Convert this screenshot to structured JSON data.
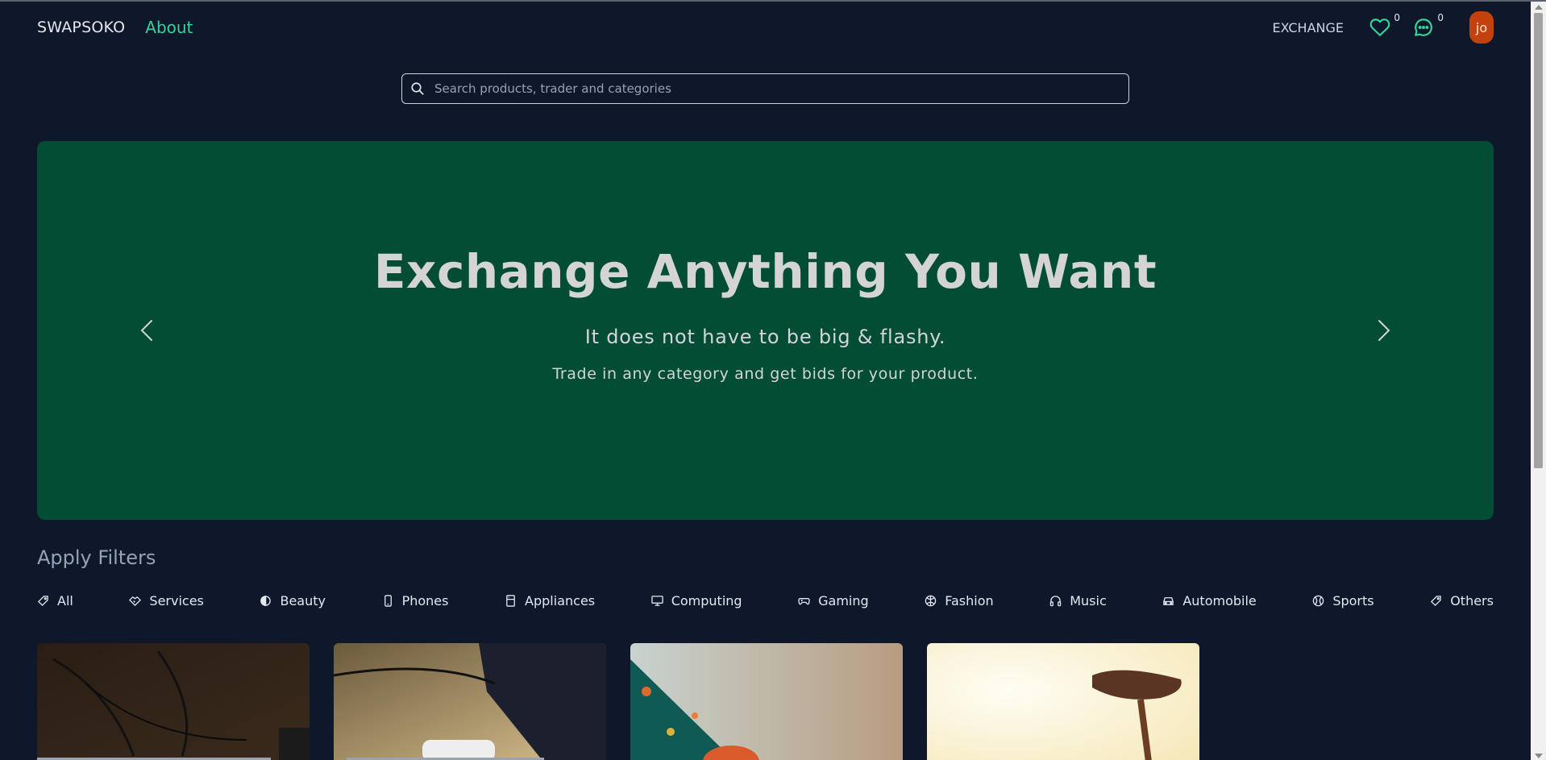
{
  "nav": {
    "brand": "SWAPSOKO",
    "about": "About",
    "exchange": "EXCHANGE",
    "favorites_count": "0",
    "messages_count": "0",
    "avatar_initials": "jo"
  },
  "search": {
    "placeholder": "Search products, trader and categories"
  },
  "hero": {
    "title": "Exchange Anything You Want",
    "subtitle": "It does not have to be big & flashy.",
    "tagline": "Trade in any category and get bids for your product."
  },
  "filters": {
    "title": "Apply Filters",
    "items": [
      {
        "label": "All",
        "icon": "tag-icon"
      },
      {
        "label": "Services",
        "icon": "handshake-icon"
      },
      {
        "label": "Beauty",
        "icon": "beauty-icon"
      },
      {
        "label": "Phones",
        "icon": "phone-icon"
      },
      {
        "label": "Appliances",
        "icon": "appliance-icon"
      },
      {
        "label": "Computing",
        "icon": "monitor-icon"
      },
      {
        "label": "Gaming",
        "icon": "gamepad-icon"
      },
      {
        "label": "Fashion",
        "icon": "shirt-icon"
      },
      {
        "label": "Music",
        "icon": "headphones-icon"
      },
      {
        "label": "Automobile",
        "icon": "car-icon"
      },
      {
        "label": "Sports",
        "icon": "ball-icon"
      },
      {
        "label": "Others",
        "icon": "tag-icon"
      }
    ]
  },
  "colors": {
    "background": "#0f172a",
    "hero": "#024d34",
    "accent": "#34d399",
    "avatar": "#c2410c"
  }
}
